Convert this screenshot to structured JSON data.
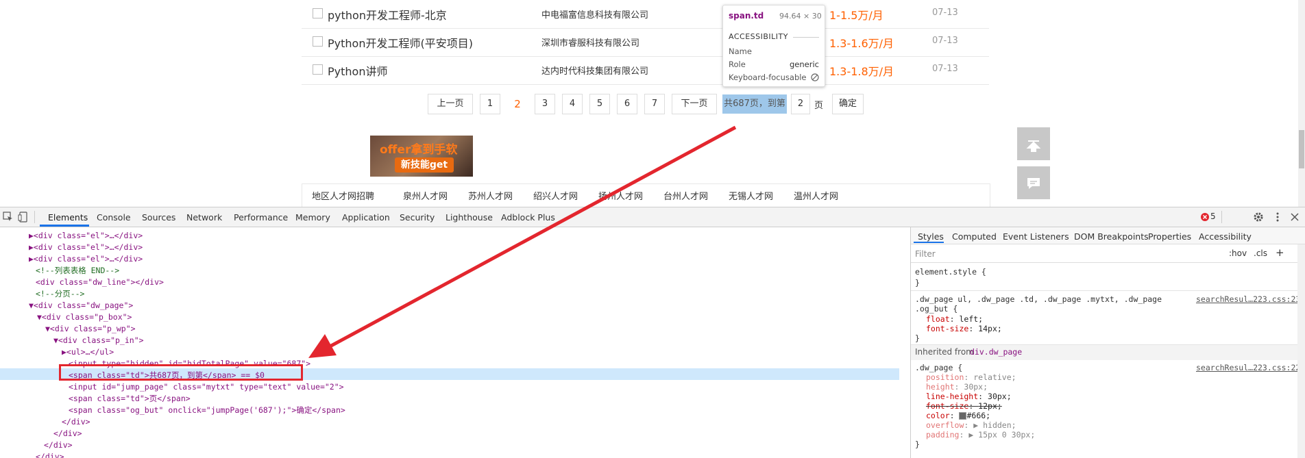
{
  "jobs": [
    {
      "title": "python开发工程师-北京",
      "company": "中电福富信息科技有限公司",
      "salary": "1-1.5万/月",
      "date": "07-13"
    },
    {
      "title": "Python开发工程师(平安项目)",
      "company": "深圳市睿服科技有限公司",
      "salary": "1.3-1.6万/月",
      "date": "07-13"
    },
    {
      "title": "Python讲师",
      "company": "达内时代科技集团有限公司",
      "salary": "1.3-1.8万/月",
      "date": "07-13"
    }
  ],
  "pagination": {
    "prev": "上一页",
    "pages": [
      "1",
      "2",
      "3",
      "4",
      "5",
      "6",
      "7"
    ],
    "current": "2",
    "next": "下一页",
    "total_text": "共687页，到第",
    "jump_value": "2",
    "page_suffix": "页",
    "confirm": "确定"
  },
  "ad": {
    "line1": "offer拿到手软",
    "line2": "新技能get"
  },
  "footer_links": [
    "地区人才网招聘",
    "泉州人才网",
    "苏州人才网",
    "绍兴人才网",
    "扬州人才网",
    "台州人才网",
    "无锡人才网",
    "温州人才网"
  ],
  "tooltip": {
    "selector": "span.td",
    "size": "94.64 × 30",
    "section": "ACCESSIBILITY",
    "rows": [
      {
        "label": "Name",
        "value": ""
      },
      {
        "label": "Role",
        "value": "generic"
      },
      {
        "label": "Keyboard-focusable",
        "value": ""
      }
    ]
  },
  "devtools": {
    "tabs": [
      "Elements",
      "Console",
      "Sources",
      "Network",
      "Performance",
      "Memory",
      "Application",
      "Security",
      "Lighthouse",
      "Adblock Plus"
    ],
    "active_tab": "Elements",
    "error_count": "5",
    "styles_tabs": [
      "Styles",
      "Computed",
      "Event Listeners",
      "DOM Breakpoints",
      "Properties",
      "Accessibility"
    ],
    "filter_placeholder": "Filter",
    "hov": ":hov",
    "cls": ".cls",
    "element_style": "element.style {",
    "close_brace": "}",
    "rule1_selector_a": ".dw_page ul, .dw_page .td, .dw_page .mytxt, .dw_page",
    "rule1_selector_b": ".og_but {",
    "rule1_source": "searchResul…223.css:230",
    "rule1_props": [
      {
        "name": "float",
        "value": "left;"
      },
      {
        "name": "font-size",
        "value": "14px;"
      }
    ],
    "inherited_label": "Inherited from",
    "inherited_from": "div.dw_page",
    "rule2_selector": ".dw_page {",
    "rule2_source": "searchResul…223.css:226",
    "rule2_props": [
      {
        "name": "position",
        "value": "relative;",
        "dim": true
      },
      {
        "name": "height",
        "value": "30px;",
        "dim": true
      },
      {
        "name": "line-height",
        "value": "30px;"
      },
      {
        "name": "font-size",
        "value": "12px;",
        "strike": true
      },
      {
        "name": "color",
        "value": "#666;"
      },
      {
        "name": "overflow",
        "value": "▶ hidden;",
        "dim": true
      },
      {
        "name": "padding",
        "value": "▶ 15px 0 30px;",
        "dim": true
      }
    ],
    "code_lines": [
      "▶<div class=\"el\">…</div>",
      "▶<div class=\"el\">…</div>",
      "▶<div class=\"el\">…</div>",
      "<!--列表表格 END-->",
      "<div class=\"dw_line\"></div>",
      "<!--分页-->",
      "▼<div class=\"dw_page\">",
      "▼<div class=\"p_box\">",
      "▼<div class=\"p_wp\">",
      "▼<div class=\"p_in\">",
      "▶<ul>…</ul>",
      "<input type=\"hidden\" id=\"hidTotalPage\" value=\"687\">",
      "<span class=\"td\">共687页，到第</span> == $0",
      "<input id=\"jump_page\" class=\"mytxt\" type=\"text\" value=\"2\">",
      "<span class=\"td\">页</span>",
      "<span class=\"og_but\" onclick=\"jumpPage('687');\">确定</span>",
      "</div>",
      "</div>",
      "</div>",
      "</div>"
    ]
  },
  "colors": {
    "accent": "#ff6000",
    "highlight_box": "#e3262e",
    "arrow": "#e3262e",
    "devtools_blue": "#1a73e8"
  }
}
